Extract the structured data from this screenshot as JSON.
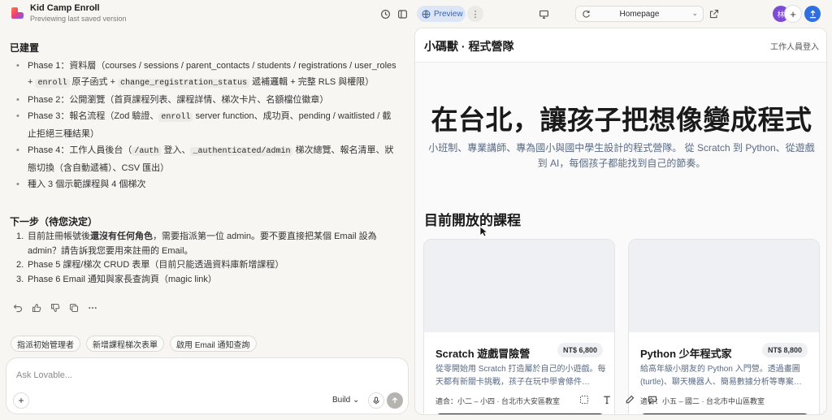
{
  "topbar": {
    "project_name": "Kid Camp Enroll",
    "project_subtitle": "Previewing last saved version",
    "preview_label": "Preview",
    "route": "Homepage",
    "avatar_initial": "林"
  },
  "chat": {
    "done_heading": "已建置",
    "phases": [
      {
        "segments": [
          "Phase 1：資料層（courses / sessions / parent_contacts / students / registrations / user_roles + ",
          "enroll",
          " 原子函式 + ",
          "change_registration_status",
          " 遞補邏輯 + 完整 RLS 與權限）"
        ]
      },
      {
        "segments": [
          "Phase 2：公開瀏覽（首頁課程列表、課程詳情、梯次卡片、名額檔位徽章）"
        ]
      },
      {
        "segments": [
          "Phase 3：報名流程（Zod 驗證、",
          "enroll",
          " server function、成功頁、pending / waitlisted / 截止拒絕三種結果）"
        ]
      },
      {
        "segments": [
          "Phase 4：工作人員後台（",
          "/auth",
          " 登入、",
          "_authenticated/admin",
          " 梯次總覽、報名清單、狀態切換（含自動遞補）、CSV 匯出）"
        ]
      },
      {
        "segments": [
          "種入 3 個示範課程與 4 個梯次"
        ]
      }
    ],
    "next_heading": "下一步（待您決定）",
    "next_steps": [
      {
        "num": "1.",
        "pre": "目前註冊帳號後",
        "bold": "還沒有任何角色",
        "post": "，需要指派第一位 admin。要不要直接把某個 Email 設為 admin？請告訴我您要用來註冊的 Email。"
      },
      {
        "num": "2.",
        "pre": "Phase 5 課程/梯次 CRUD 表單（目前只能透過資料庫新增課程）",
        "bold": "",
        "post": ""
      },
      {
        "num": "3.",
        "pre": "Phase 6 Email 通知與家長查詢頁（magic link）",
        "bold": "",
        "post": ""
      }
    ],
    "suggestions": [
      "指派初始管理者",
      "新增課程梯次表單",
      "啟用 Email 通知查詢"
    ],
    "composer_placeholder": "Ask Lovable...",
    "mode_label": "Build"
  },
  "site": {
    "brand": "小碼獸 · 程式營隊",
    "login_link": "工作人員登入",
    "hero_title": "在台北，讓孩子把想像變成程式",
    "hero_subtitle": "小班制、專業講師、專為國小與國中學生設計的程式營隊。 從 Scratch 到 Python、從遊戲到 AI，每個孩子都能找到自己的節奏。",
    "section_title": "目前開放的課程",
    "courses": [
      {
        "title": "Scratch 遊戲冒險營",
        "price": "NT$ 6,800",
        "desc": "從零開始用 Scratch 打造屬於自己的小遊戲。每天都有新關卡挑戰，孩子在玩中學會條件…",
        "meta": "適合：小二 – 小四 · 台北市大安區教室"
      },
      {
        "title": "Python 少年程式家",
        "price": "NT$ 8,800",
        "desc": "給高年級小朋友的 Python 入門營。透過畫圖 (turtle)、聊天機器人、簡易數據分析等專案…",
        "meta": "適合：小五 – 國二 · 台北市中山區教室"
      }
    ]
  },
  "colors": {
    "accent": "#2f6fe0",
    "preview_pill_bg": "#dce6f7",
    "hero_subtitle": "#5a6b86",
    "avatar": "#7d4bd6"
  }
}
